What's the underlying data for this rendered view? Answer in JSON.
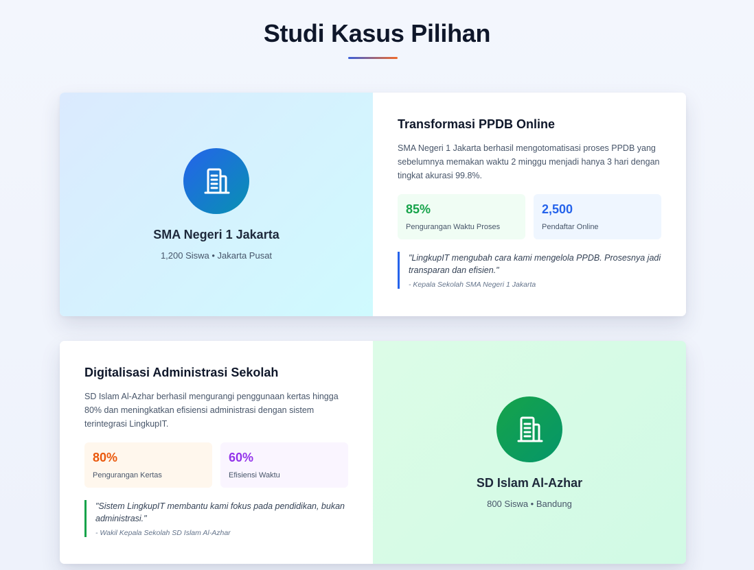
{
  "section": {
    "title": "Studi Kasus Pilihan",
    "accent_start": "#3b5fd9",
    "accent_end": "#f06a2a"
  },
  "cases": [
    {
      "school": {
        "name": "SMA Negeri 1 Jakarta",
        "meta": "1,200 Siswa • Jakarta Pusat",
        "icon": "building-icon",
        "color": "#2563eb"
      },
      "title": "Transformasi PPDB Online",
      "description": "SMA Negeri 1 Jakarta berhasil mengotomatisasi proses PPDB yang sebelumnya memakan waktu 2 minggu menjadi hanya 3 hari dengan tingkat akurasi 99.8%.",
      "stats": [
        {
          "value": "85%",
          "label": "Pengurangan Waktu Proses",
          "color": "#16a34a"
        },
        {
          "value": "2,500",
          "label": "Pendaftar Online",
          "color": "#2563eb"
        }
      ],
      "quote": {
        "text": "\"LingkupIT mengubah cara kami mengelola PPDB. Prosesnya jadi transparan dan efisien.\"",
        "author": "- Kepala Sekolah SMA Negeri 1 Jakarta"
      }
    },
    {
      "school": {
        "name": "SD Islam Al-Azhar",
        "meta": "800 Siswa • Bandung",
        "icon": "building-icon",
        "color": "#16a34a"
      },
      "title": "Digitalisasi Administrasi Sekolah",
      "description": "SD Islam Al-Azhar berhasil mengurangi penggunaan kertas hingga 80% dan meningkatkan efisiensi administrasi dengan sistem terintegrasi LingkupIT.",
      "stats": [
        {
          "value": "80%",
          "label": "Pengurangan Kertas",
          "color": "#ea580c"
        },
        {
          "value": "60%",
          "label": "Efisiensi Waktu",
          "color": "#9333ea"
        }
      ],
      "quote": {
        "text": "\"Sistem LingkupIT membantu kami fokus pada pendidikan, bukan administrasi.\"",
        "author": "- Wakil Kepala Sekolah SD Islam Al-Azhar"
      }
    }
  ]
}
